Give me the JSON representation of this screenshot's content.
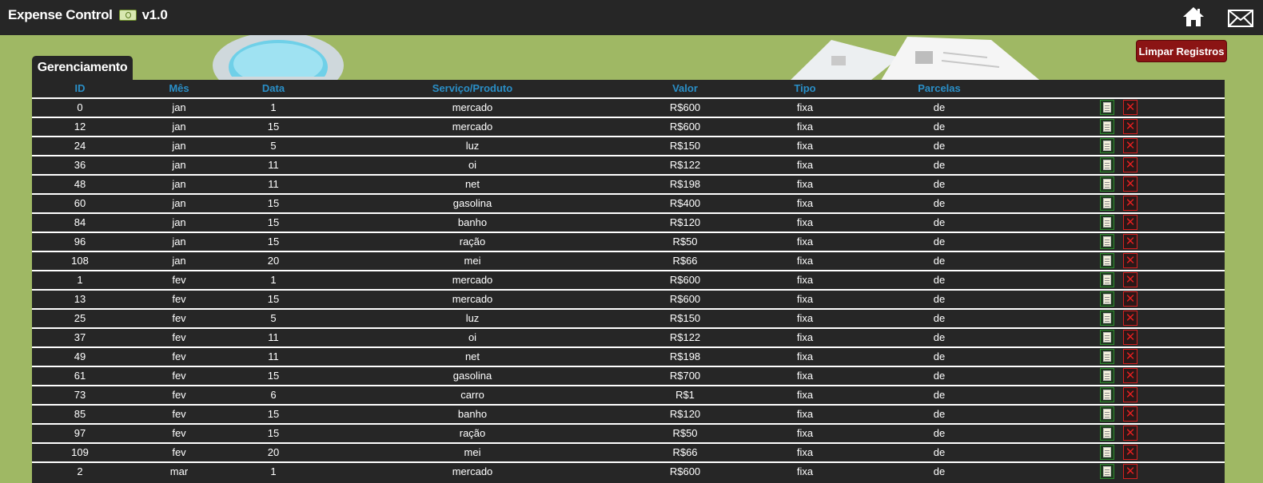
{
  "app": {
    "title": "Expense Control",
    "version": "v1.0"
  },
  "header": {
    "home_icon": "home-icon",
    "mail_icon": "mail-icon"
  },
  "clear_button": {
    "label": "Limpar Registros"
  },
  "tab": {
    "label": "Gerenciamento"
  },
  "table": {
    "headers": [
      "ID",
      "Mês",
      "Data",
      "Serviço/Produto",
      "Valor",
      "Tipo",
      "Parcelas"
    ],
    "rows": [
      {
        "id": "0",
        "mes": "jan",
        "data": "1",
        "servico": "mercado",
        "valor": "R$600",
        "tipo": "fixa",
        "parcelas": "de"
      },
      {
        "id": "12",
        "mes": "jan",
        "data": "15",
        "servico": "mercado",
        "valor": "R$600",
        "tipo": "fixa",
        "parcelas": "de"
      },
      {
        "id": "24",
        "mes": "jan",
        "data": "5",
        "servico": "luz",
        "valor": "R$150",
        "tipo": "fixa",
        "parcelas": "de"
      },
      {
        "id": "36",
        "mes": "jan",
        "data": "11",
        "servico": "oi",
        "valor": "R$122",
        "tipo": "fixa",
        "parcelas": "de"
      },
      {
        "id": "48",
        "mes": "jan",
        "data": "11",
        "servico": "net",
        "valor": "R$198",
        "tipo": "fixa",
        "parcelas": "de"
      },
      {
        "id": "60",
        "mes": "jan",
        "data": "15",
        "servico": "gasolina",
        "valor": "R$400",
        "tipo": "fixa",
        "parcelas": "de"
      },
      {
        "id": "84",
        "mes": "jan",
        "data": "15",
        "servico": "banho",
        "valor": "R$120",
        "tipo": "fixa",
        "parcelas": "de"
      },
      {
        "id": "96",
        "mes": "jan",
        "data": "15",
        "servico": "ração",
        "valor": "R$50",
        "tipo": "fixa",
        "parcelas": "de"
      },
      {
        "id": "108",
        "mes": "jan",
        "data": "20",
        "servico": "mei",
        "valor": "R$66",
        "tipo": "fixa",
        "parcelas": "de"
      },
      {
        "id": "1",
        "mes": "fev",
        "data": "1",
        "servico": "mercado",
        "valor": "R$600",
        "tipo": "fixa",
        "parcelas": "de"
      },
      {
        "id": "13",
        "mes": "fev",
        "data": "15",
        "servico": "mercado",
        "valor": "R$600",
        "tipo": "fixa",
        "parcelas": "de"
      },
      {
        "id": "25",
        "mes": "fev",
        "data": "5",
        "servico": "luz",
        "valor": "R$150",
        "tipo": "fixa",
        "parcelas": "de"
      },
      {
        "id": "37",
        "mes": "fev",
        "data": "11",
        "servico": "oi",
        "valor": "R$122",
        "tipo": "fixa",
        "parcelas": "de"
      },
      {
        "id": "49",
        "mes": "fev",
        "data": "11",
        "servico": "net",
        "valor": "R$198",
        "tipo": "fixa",
        "parcelas": "de"
      },
      {
        "id": "61",
        "mes": "fev",
        "data": "15",
        "servico": "gasolina",
        "valor": "R$700",
        "tipo": "fixa",
        "parcelas": "de"
      },
      {
        "id": "73",
        "mes": "fev",
        "data": "6",
        "servico": "carro",
        "valor": "R$1",
        "tipo": "fixa",
        "parcelas": "de"
      },
      {
        "id": "85",
        "mes": "fev",
        "data": "15",
        "servico": "banho",
        "valor": "R$120",
        "tipo": "fixa",
        "parcelas": "de"
      },
      {
        "id": "97",
        "mes": "fev",
        "data": "15",
        "servico": "ração",
        "valor": "R$50",
        "tipo": "fixa",
        "parcelas": "de"
      },
      {
        "id": "109",
        "mes": "fev",
        "data": "20",
        "servico": "mei",
        "valor": "R$66",
        "tipo": "fixa",
        "parcelas": "de"
      },
      {
        "id": "2",
        "mes": "mar",
        "data": "1",
        "servico": "mercado",
        "valor": "R$600",
        "tipo": "fixa",
        "parcelas": "de"
      }
    ],
    "edit_icon": "edit-icon",
    "delete_icon": "delete-icon",
    "delete_glyph": "✕"
  },
  "colors": {
    "page_background": "#9fb864",
    "header_background": "#262626",
    "column_header_text": "#2a8fc7",
    "clear_button": "#8b1414",
    "delete_icon": "#e02020",
    "edit_icon_border": "#2f8a2f"
  }
}
